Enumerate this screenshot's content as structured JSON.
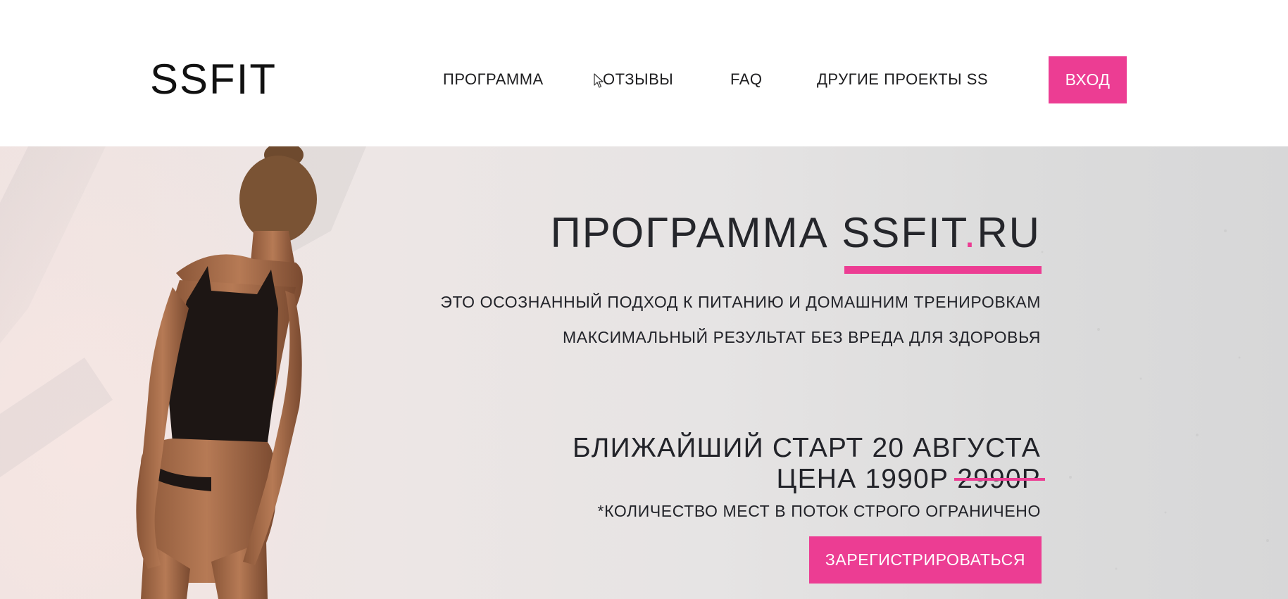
{
  "header": {
    "logo": "SSFIT",
    "nav": {
      "program": "ПРОГРАММА",
      "reviews": "ОТЗЫВЫ",
      "faq": "FAQ",
      "other_projects": "ДРУГИЕ ПРОЕКТЫ SS"
    },
    "login_label": "ВХОД"
  },
  "hero": {
    "title_main": "ПРОГРАММА SSFIT",
    "title_dot": ".",
    "title_tld": "RU",
    "subtitle_1": "ЭТО ОСОЗНАННЫЙ ПОДХОД К ПИТАНИЮ И ДОМАШНИМ ТРЕНИРОВКАМ",
    "subtitle_2": "МАКСИМАЛЬНЫЙ РЕЗУЛЬТАТ БЕЗ ВРЕДА ДЛЯ ЗДОРОВЬЯ",
    "start_date": "БЛИЖАЙШИЙ СТАРТ 20 АВГУСТА",
    "price_label": "ЦЕНА 1990Р",
    "old_price": "2990Р",
    "limit_note": "*КОЛИЧЕСТВО МЕСТ В ПОТОК СТРОГО ОГРАНИЧЕНО",
    "register_label": "ЗАРЕГИСТРИРОВАТЬСЯ"
  },
  "colors": {
    "accent": "#ec3d93",
    "text": "#222329",
    "background": "#ffffff"
  },
  "icons": [
    "cursor-icon"
  ]
}
